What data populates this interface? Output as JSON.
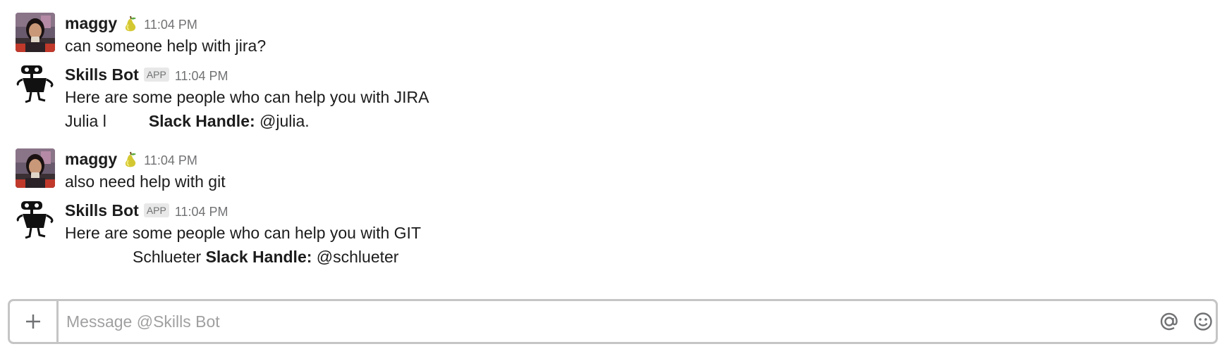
{
  "messages": [
    {
      "sender": "maggy",
      "time": "11:04 PM",
      "avatar": "user-photo-avatar",
      "status_emoji": "pear-emoji",
      "lines": [
        "can someone help with jira?"
      ]
    },
    {
      "sender": "Skills Bot",
      "badge": "APP",
      "time": "11:04 PM",
      "avatar": "robot-avatar",
      "intro": "Here are some people who can help you with JIRA",
      "result": {
        "name": "Julia l",
        "handle_label": "Slack Handle:",
        "handle": "@julia."
      }
    },
    {
      "sender": "maggy",
      "time": "11:04 PM",
      "avatar": "user-photo-avatar",
      "status_emoji": "pear-emoji",
      "lines": [
        "also need help with git"
      ]
    },
    {
      "sender": "Skills Bot",
      "badge": "APP",
      "time": "11:04 PM",
      "avatar": "robot-avatar",
      "intro": "Here are some people who can help you with GIT",
      "result": {
        "name": "Schlueter",
        "handle_label": "Slack Handle:",
        "handle": "@schlueter"
      }
    }
  ],
  "composer": {
    "placeholder": "Message @Skills Bot",
    "value": "",
    "add_icon": "plus-icon",
    "mention_icon": "at-sign-icon",
    "emoji_icon": "smiley-icon"
  },
  "colors": {
    "text": "#1d1c1d",
    "muted": "#717274",
    "border": "#c5c5c5",
    "badge_bg": "#e8e8e8"
  }
}
